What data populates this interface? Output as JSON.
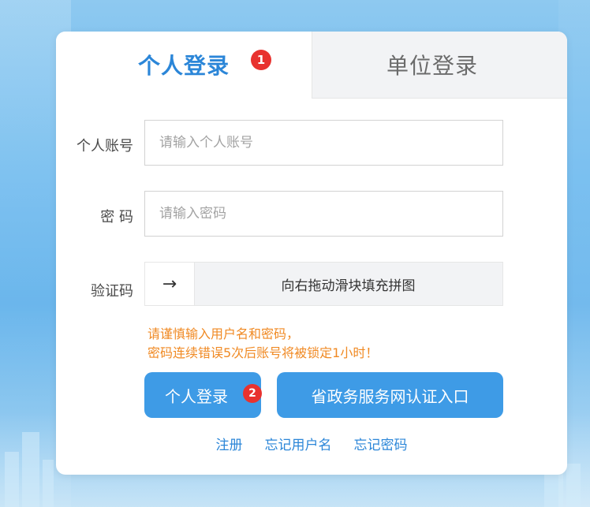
{
  "tabs": {
    "personal": "个人登录",
    "unit": "单位登录",
    "badge_personal": "1"
  },
  "form": {
    "account_label": "个人账号",
    "account_placeholder": "请输入个人账号",
    "password_label": "密 码",
    "password_placeholder": "请输入密码",
    "captcha_label": "验证码",
    "slider_handle": "→",
    "slider_text": "向右拖动滑块填充拼图"
  },
  "warning": {
    "line1": "请谨慎输入用户名和密码，",
    "line2": "密码连续错误5次后账号将被锁定1小时！"
  },
  "buttons": {
    "login": "个人登录",
    "login_badge": "2",
    "gov_portal": "省政务服务网认证入口"
  },
  "links": {
    "register": "注册",
    "forgot_username": "忘记用户名",
    "forgot_password": "忘记密码"
  },
  "colors": {
    "accent": "#2b86d8",
    "button": "#3e9be6",
    "warning": "#f08a24",
    "badge": "#e8322f"
  }
}
